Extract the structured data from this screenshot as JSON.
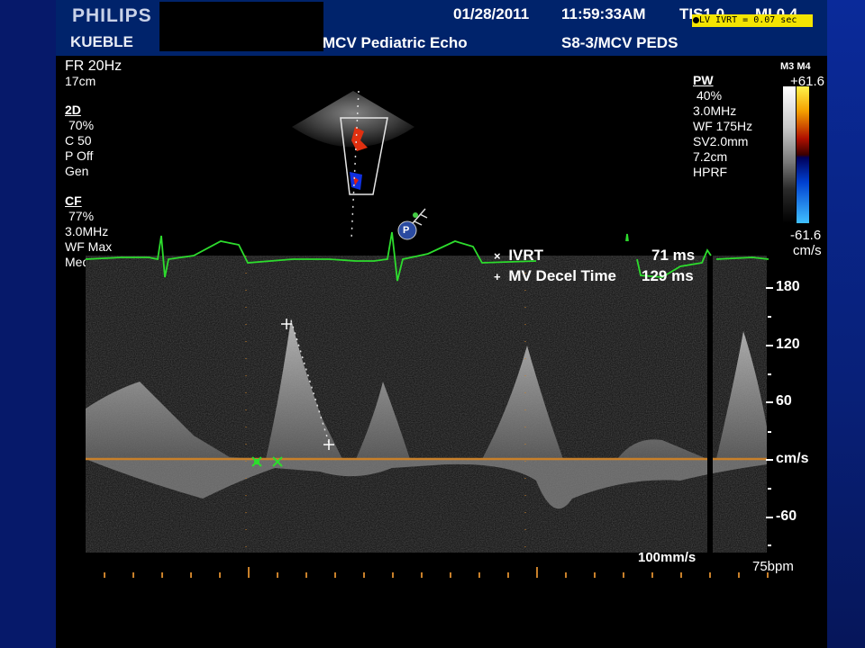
{
  "header": {
    "brand": "PHILIPS",
    "institution": "KUEBLE",
    "date": "01/28/2011",
    "time": "11:59:33AM",
    "tis": "TIS1.0",
    "mi": "MI 0.4",
    "study": "MCV Pediatric Echo",
    "probe": "S8-3/MCV PEDS",
    "callout": "LV IVRT = 0.07 sec"
  },
  "left_params": {
    "frame_rate": "FR 20Hz",
    "depth": "17cm",
    "twod": {
      "title": "2D",
      "gain": "70%",
      "compress": "C 50",
      "persist": "P Off",
      "mode": "Gen"
    },
    "cf": {
      "title": "CF",
      "gain": "77%",
      "freq": "3.0MHz",
      "wall_filter": "WF Max",
      "level": "Med"
    }
  },
  "right_params": {
    "mode_title": "PW",
    "gain": "40%",
    "freq": "3.0MHz",
    "wall_filter": "WF 175Hz",
    "sample_volume": "SV2.0mm",
    "gate_depth": "7.2cm",
    "prf": "HPRF"
  },
  "color_bar": {
    "map": "M3 M4",
    "max": "+61.6",
    "min": "-61.6",
    "unit": "cm/s"
  },
  "measurements": [
    {
      "symbol": "×",
      "name": "IVRT",
      "value": "71 ms"
    },
    {
      "symbol": "+",
      "name": "MV Decel Time",
      "value": "129 ms"
    }
  ],
  "doppler_scale": {
    "labels": [
      "180",
      "120",
      "60",
      "cm/s",
      "-60"
    ]
  },
  "footer": {
    "sweep_speed": "100mm/s",
    "heart_rate": "75bpm"
  },
  "sample_gate_label": "P",
  "colors": {
    "ecg": "#2ddc2d",
    "baseline": "#c8802a",
    "callout_bg": "#f4e400",
    "header_bg": "#00236b"
  }
}
